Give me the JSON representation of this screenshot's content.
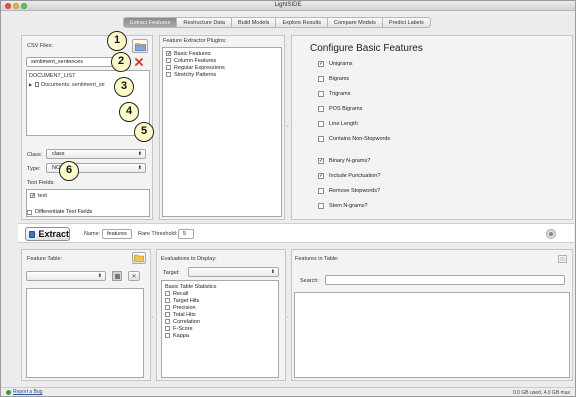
{
  "window": {
    "title": "LightSIDE"
  },
  "tabs": [
    "Extract Features",
    "Restructure Data",
    "Build Models",
    "Explore Results",
    "Compare Models",
    "Predict Labels"
  ],
  "csv": {
    "label": "CSV Files:",
    "file_value": "sentiment_sentences",
    "tree_root": "DOCUMENT_LIST",
    "tree_child": "Documents: sentiment_se"
  },
  "class_field": {
    "label": "Class:",
    "value": "class"
  },
  "type_field": {
    "label": "Type:",
    "value": "NOMINAL"
  },
  "text_fields": {
    "label": "Text Fields:",
    "items": [
      {
        "label": "text",
        "checked": true
      }
    ]
  },
  "differentiate": {
    "label": "Differentiate Text Fields",
    "checked": false
  },
  "plugins": {
    "label": "Feature Extractor Plugins:",
    "items": [
      {
        "label": "Basic Features",
        "checked": true
      },
      {
        "label": "Column Features",
        "checked": false
      },
      {
        "label": "Regular Expressions",
        "checked": false
      },
      {
        "label": "Stretchy Patterns",
        "checked": false
      }
    ]
  },
  "configure": {
    "title": "Configure Basic Features",
    "group1": [
      {
        "label": "Unigrams",
        "checked": true
      },
      {
        "label": "Bigrams",
        "checked": false
      },
      {
        "label": "Trigrams",
        "checked": false
      },
      {
        "label": "POS Bigrams",
        "checked": false
      },
      {
        "label": "Line Length",
        "checked": false
      },
      {
        "label": "Contains Non-Stopwords",
        "checked": false
      }
    ],
    "group2": [
      {
        "label": "Binary N-grams?",
        "checked": true
      },
      {
        "label": "Include Punctuation?",
        "checked": true
      },
      {
        "label": "Remove Stopwords?",
        "checked": false
      },
      {
        "label": "Stem N-grams?",
        "checked": false
      }
    ]
  },
  "extract_bar": {
    "button_label": "Extract",
    "name_label": "Name:",
    "name_value": "features",
    "threshold_label": "Rare Threshold:",
    "threshold_value": "5"
  },
  "feature_table": {
    "label": "Feature Table:"
  },
  "evaluations": {
    "label": "Evaluations to Display:",
    "target_label": "Target:",
    "list_header": "Basic Table Statistics",
    "items": [
      "Recall",
      "Target Hits",
      "Precision",
      "Total Hits",
      "Correlation",
      "F-Score",
      "Kappa"
    ]
  },
  "features_in_table": {
    "label": "Features in Table:",
    "search_label": "Search:"
  },
  "status": {
    "report_bug": "Report a Bug",
    "memory": "0.0 GB used, 4.0 GB max"
  },
  "callouts": [
    "1",
    "2",
    "3",
    "4",
    "5",
    "6"
  ],
  "colors": {
    "accent_blue": "#3d72c9",
    "callout_fill": "#fffbc8",
    "bug_green": "#3a9a3a",
    "delete_red": "#d9362b"
  }
}
